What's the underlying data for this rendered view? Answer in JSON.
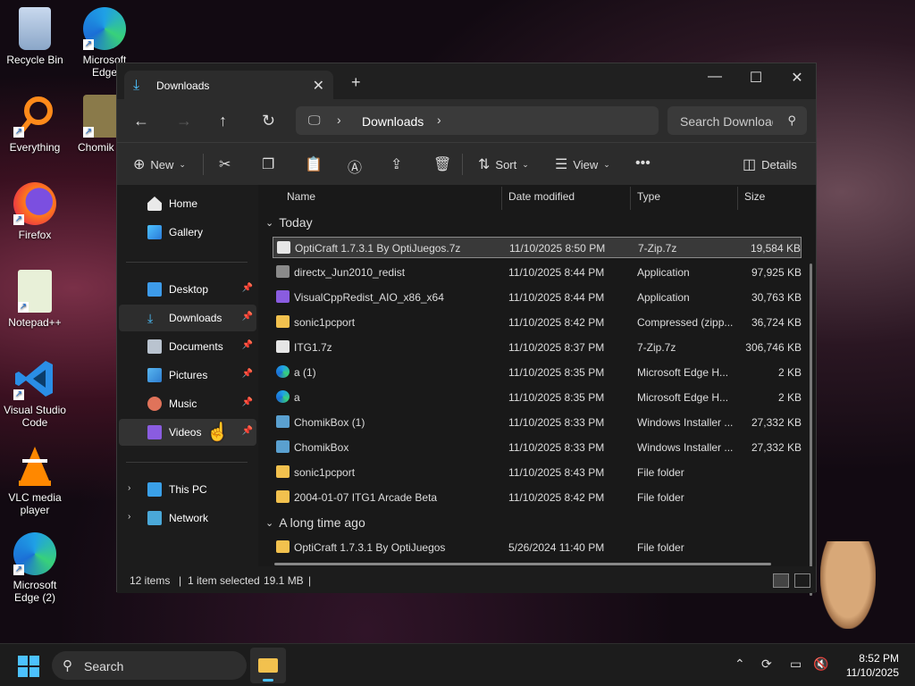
{
  "desktop": {
    "icons": [
      {
        "label": "Recycle Bin",
        "icon": "recycle-bin-icon"
      },
      {
        "label": "Microsoft Edge",
        "icon": "edge-icon"
      },
      {
        "label": "Everything",
        "icon": "everything-search-icon"
      },
      {
        "label": "Chomik",
        "icon": "chomikbox-icon"
      },
      {
        "label": "Firefox",
        "icon": "firefox-icon"
      },
      {
        "label": "Notepad++",
        "icon": "notepad-plus-plus-icon"
      },
      {
        "label": "Visual Studio Code",
        "icon": "vscode-icon"
      },
      {
        "label": "VLC media player",
        "icon": "vlc-icon"
      },
      {
        "label": "Microsoft Edge (2)",
        "icon": "edge-icon"
      }
    ]
  },
  "explorer": {
    "tab_title": "Downloads",
    "breadcrumb": "Downloads",
    "search_placeholder": "Search Downloads",
    "toolbar": {
      "new": "New",
      "sort": "Sort",
      "view": "View",
      "details": "Details"
    },
    "sidebar": {
      "home": "Home",
      "gallery": "Gallery",
      "desktop": "Desktop",
      "downloads": "Downloads",
      "documents": "Documents",
      "pictures": "Pictures",
      "music": "Music",
      "videos": "Videos",
      "this_pc": "This PC",
      "network": "Network"
    },
    "columns": {
      "name": "Name",
      "date": "Date modified",
      "type": "Type",
      "size": "Size"
    },
    "groups": {
      "today": "Today",
      "long_ago": "A long time ago"
    },
    "files": [
      {
        "name": "OptiCraft 1.7.3.1 By OptiJuegos.7z",
        "date": "11/10/2025 8:50 PM",
        "type": "7-Zip.7z",
        "size": "19,584 KB"
      },
      {
        "name": "directx_Jun2010_redist",
        "date": "11/10/2025 8:44 PM",
        "type": "Application",
        "size": "97,925 KB"
      },
      {
        "name": "VisualCppRedist_AIO_x86_x64",
        "date": "11/10/2025 8:44 PM",
        "type": "Application",
        "size": "30,763 KB"
      },
      {
        "name": "sonic1pcport",
        "date": "11/10/2025 8:42 PM",
        "type": "Compressed (zipp...",
        "size": "36,724 KB"
      },
      {
        "name": "ITG1.7z",
        "date": "11/10/2025 8:37 PM",
        "type": "7-Zip.7z",
        "size": "306,746 KB"
      },
      {
        "name": "a (1)",
        "date": "11/10/2025 8:35 PM",
        "type": "Microsoft Edge H...",
        "size": "2 KB"
      },
      {
        "name": "a",
        "date": "11/10/2025 8:35 PM",
        "type": "Microsoft Edge H...",
        "size": "2 KB"
      },
      {
        "name": "ChomikBox (1)",
        "date": "11/10/2025 8:33 PM",
        "type": "Windows Installer ...",
        "size": "27,332 KB"
      },
      {
        "name": "ChomikBox",
        "date": "11/10/2025 8:33 PM",
        "type": "Windows Installer ...",
        "size": "27,332 KB"
      },
      {
        "name": "sonic1pcport",
        "date": "11/10/2025 8:43 PM",
        "type": "File folder",
        "size": ""
      },
      {
        "name": "2004-01-07 ITG1 Arcade Beta",
        "date": "11/10/2025 8:42 PM",
        "type": "File folder",
        "size": ""
      },
      {
        "name": "OptiCraft 1.7.3.1 By OptiJuegos",
        "date": "5/26/2024 11:40 PM",
        "type": "File folder",
        "size": ""
      }
    ],
    "status": {
      "count": "12 items",
      "selected": "1 item selected",
      "size": "19.1 MB"
    }
  },
  "taskbar": {
    "search": "Search",
    "time": "8:52 PM",
    "date": "11/10/2025"
  },
  "colors": {
    "accent": "#4cc2ff",
    "folder": "#f2c14e",
    "window_bg": "#191919"
  }
}
